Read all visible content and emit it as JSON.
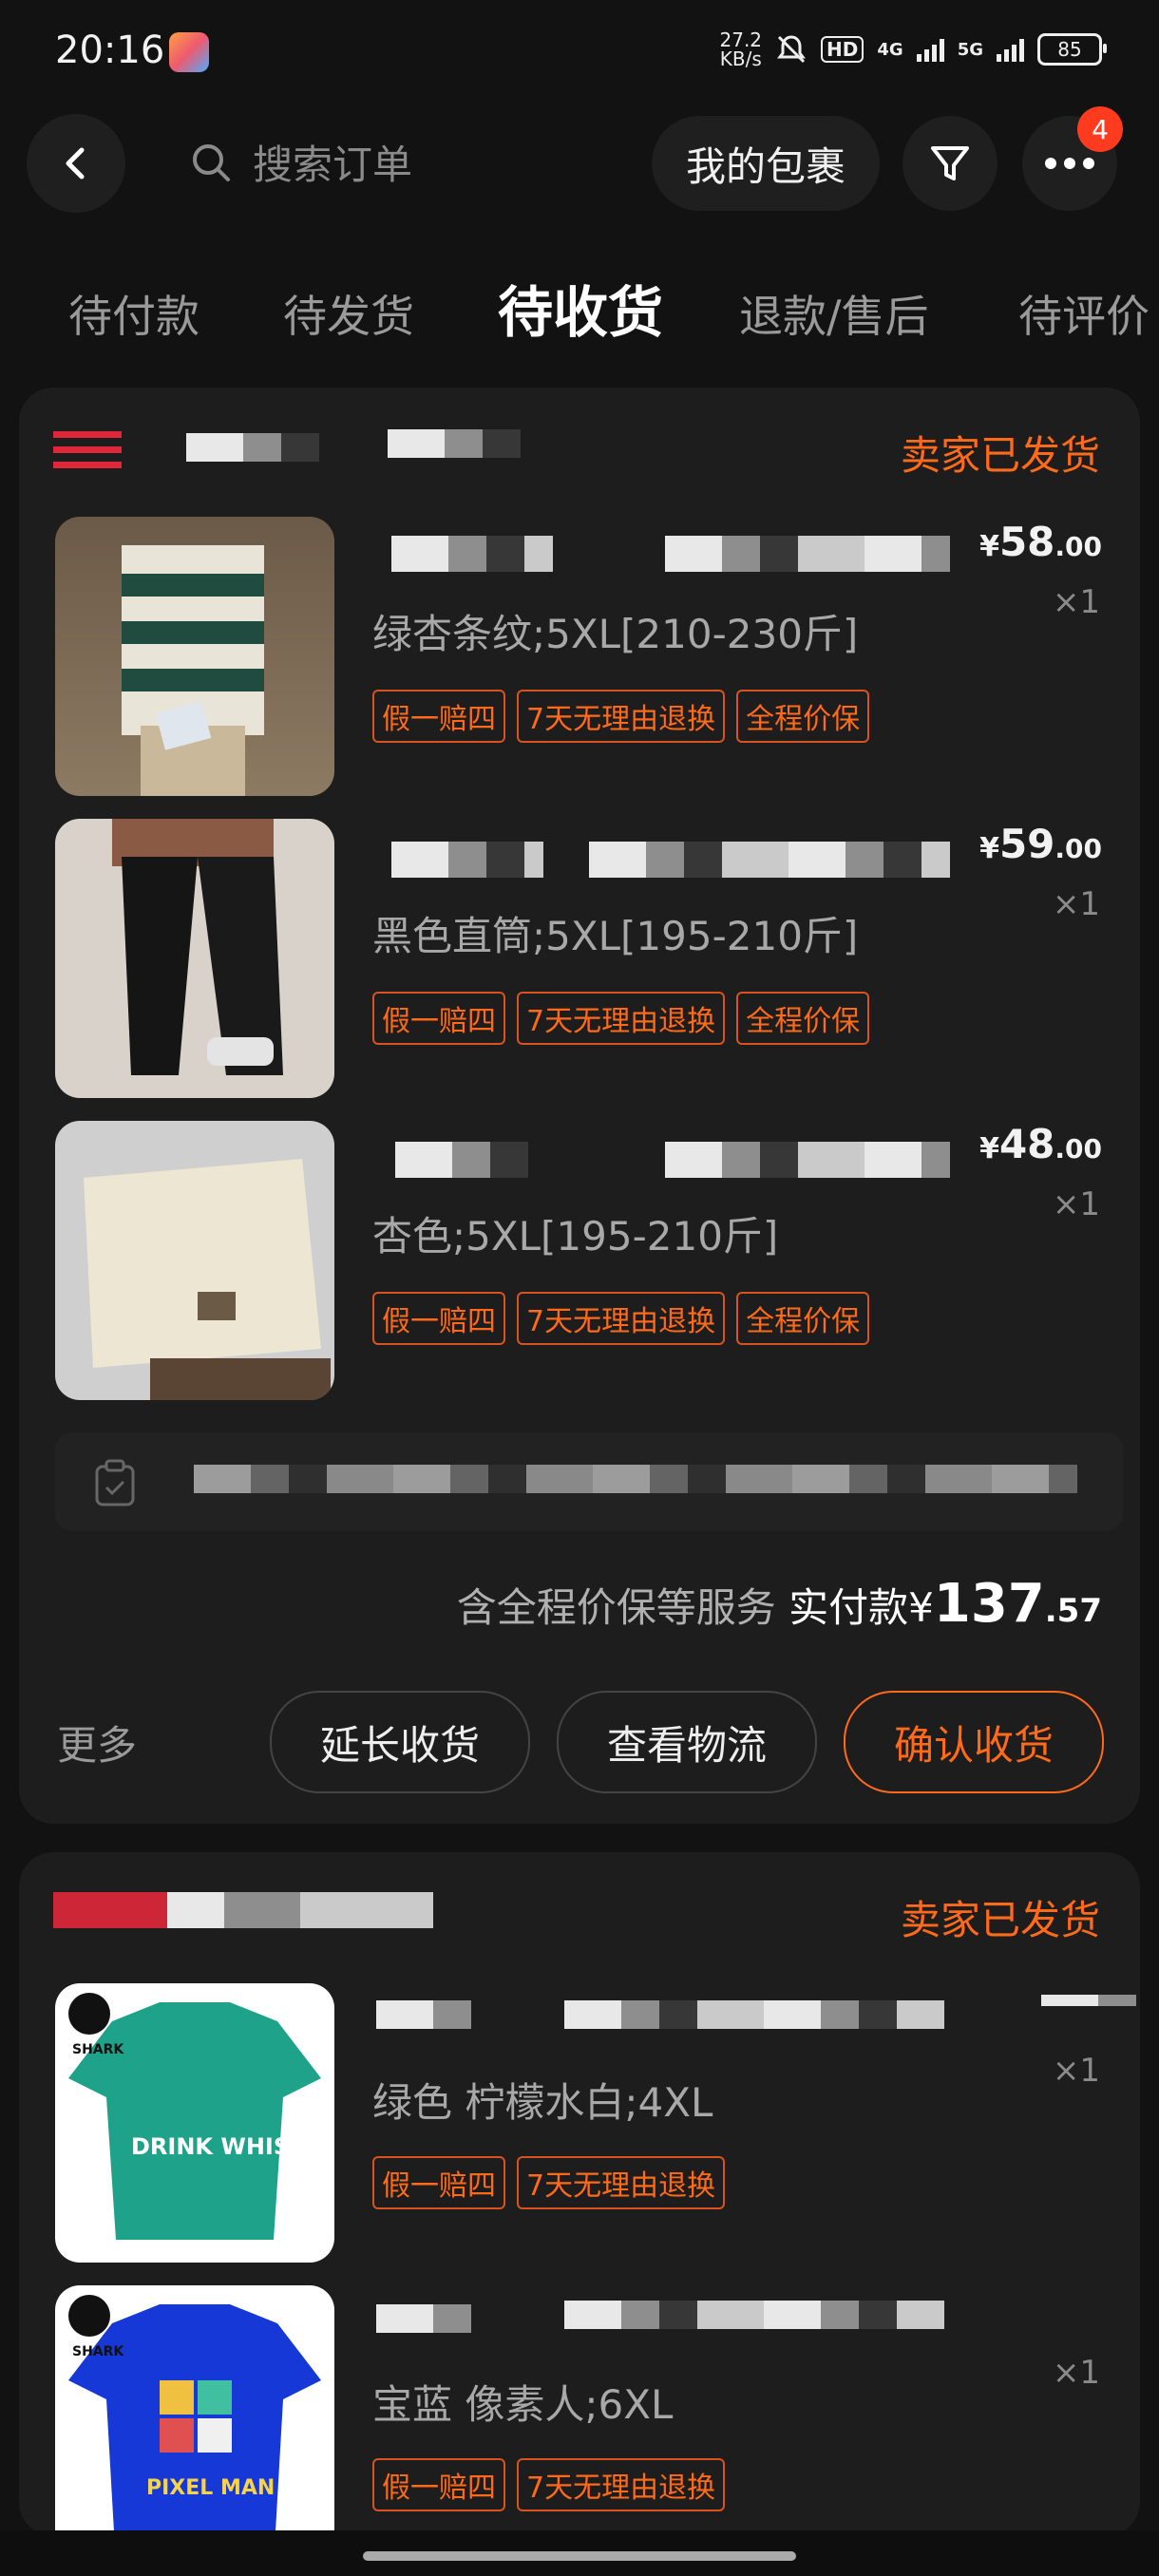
{
  "status_bar": {
    "time": "20:16",
    "net_speed_top": "27.2",
    "net_speed_bottom": "KB/s",
    "hd_label": "HD",
    "signal1": "4G",
    "signal2": "5G",
    "battery": "85"
  },
  "header": {
    "search_placeholder": "搜索订单",
    "my_packages_label": "我的包裹",
    "more_badge": "4"
  },
  "tabs": [
    {
      "label": "待付款",
      "active": false
    },
    {
      "label": "待发货",
      "active": false
    },
    {
      "label": "待收货",
      "active": true
    },
    {
      "label": "退款/售后",
      "active": false
    },
    {
      "label": "待评价",
      "active": false
    }
  ],
  "orders": [
    {
      "status": "卖家已发货",
      "items": [
        {
          "sku": "绿杏条纹;5XL[210-230斤]",
          "price_main": "58",
          "price_cents": ".00",
          "currency": "¥",
          "qty": "×1",
          "tags": [
            "假一赔四",
            "7天无理由退换",
            "全程价保"
          ]
        },
        {
          "sku": "黑色直筒;5XL[195-210斤]",
          "price_main": "59",
          "price_cents": ".00",
          "currency": "¥",
          "qty": "×1",
          "tags": [
            "假一赔四",
            "7天无理由退换",
            "全程价保"
          ]
        },
        {
          "sku": "杏色;5XL[195-210斤]",
          "price_main": "48",
          "price_cents": ".00",
          "currency": "¥",
          "qty": "×1",
          "tags": [
            "假一赔四",
            "7天无理由退换",
            "全程价保"
          ]
        }
      ],
      "summary_prefix": "含全程价保等服务",
      "paid_label": "实付款",
      "paid_currency": "¥",
      "paid_main": "137",
      "paid_cents": ".57",
      "more_label": "更多",
      "buttons": {
        "extend": "延长收货",
        "logistics": "查看物流",
        "confirm": "确认收货"
      }
    },
    {
      "status": "卖家已发货",
      "items": [
        {
          "sku": "绿色 柠檬水白;4XL",
          "qty": "×1",
          "tags": [
            "假一赔四",
            "7天无理由退换"
          ],
          "thumb_text": "DRINK WHISKY",
          "brand": "SHARK"
        },
        {
          "sku": "宝蓝 像素人;6XL",
          "qty": "×1",
          "tags": [
            "假一赔四",
            "7天无理由退换"
          ],
          "thumb_text": "PIXEL MAN",
          "brand": "SHARK"
        }
      ]
    }
  ],
  "colors": {
    "accent": "#ff6a1a",
    "background": "#121212",
    "card": "#1d1d1d"
  }
}
